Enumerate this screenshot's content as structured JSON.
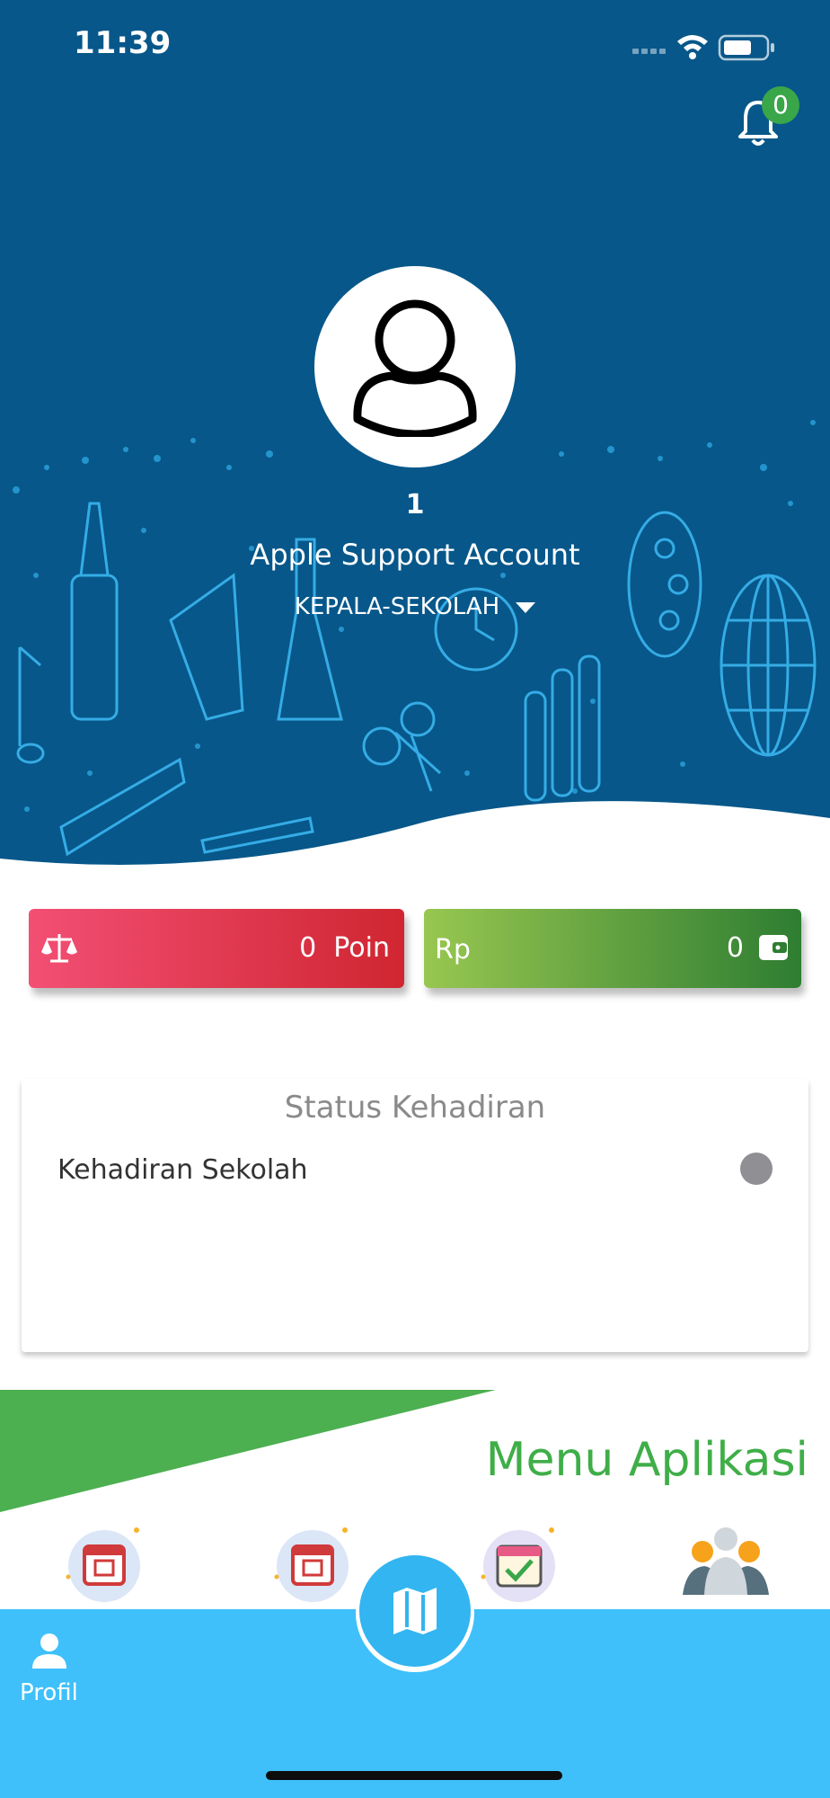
{
  "status_bar": {
    "time": "11:39"
  },
  "notifications": {
    "count": "0"
  },
  "profile": {
    "id": "1",
    "name": "Apple Support Account",
    "role": "KEPALA-SEKOLAH"
  },
  "summary": {
    "poin_value": "0",
    "poin_label": "Poin",
    "currency": "Rp",
    "balance_value": "0"
  },
  "attendance": {
    "title": "Status Kehadiran",
    "item_label": "Kehadiran Sekolah"
  },
  "menu": {
    "title": "Menu Aplikasi",
    "icons": [
      "calendar-icon",
      "calendar-icon",
      "calendar-check-icon",
      "users-group-icon"
    ]
  },
  "bottom_nav": {
    "profil_label": "Profil",
    "center_icon": "map-icon"
  },
  "colors": {
    "header_bg": "#07578a",
    "nav_bg": "#3fc0fb",
    "accent_green": "#3fae48",
    "poin_start": "#f24f74",
    "poin_end": "#d02631",
    "saldo_start": "#98c750",
    "saldo_end": "#2e7d32"
  }
}
